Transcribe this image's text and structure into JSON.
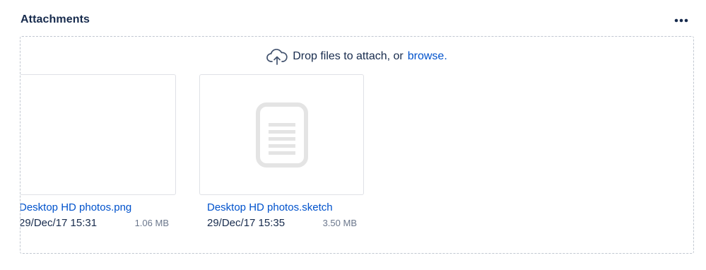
{
  "header": {
    "title": "Attachments",
    "more_icon": "ellipsis-icon"
  },
  "dropzone": {
    "icon": "cloud-upload-icon",
    "prompt": "Drop files to attach, or",
    "link": "browse."
  },
  "attachments": [
    {
      "name": "Desktop HD photos.png",
      "date": "29/Dec/17 15:31",
      "size": "1.06 MB",
      "thumbnail": "blank"
    },
    {
      "name": "Desktop HD photos.sketch",
      "date": "29/Dec/17 15:35",
      "size": "3.50 MB",
      "thumbnail": "document-icon"
    }
  ],
  "colors": {
    "text": "#172b4d",
    "link": "#0052cc",
    "muted": "#6b778c",
    "border": "#dfe1e6",
    "icon_gray": "#e4e4e4"
  }
}
